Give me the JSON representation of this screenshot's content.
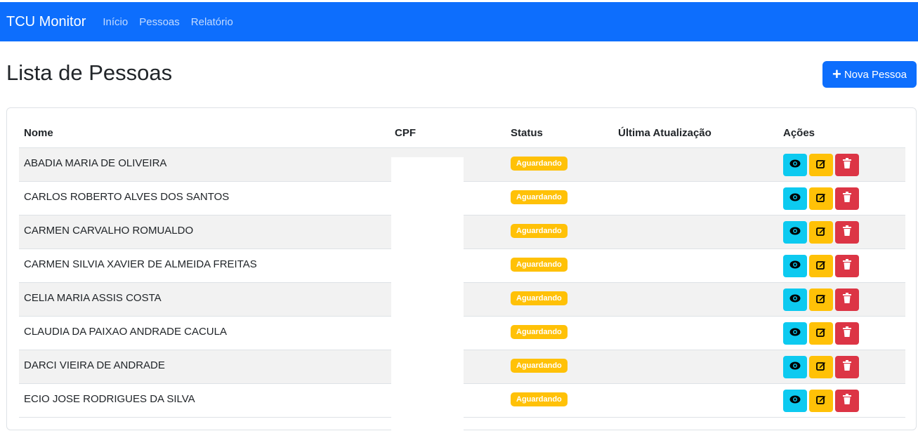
{
  "navbar": {
    "brand": "TCU Monitor",
    "links": [
      "Início",
      "Pessoas",
      "Relatório"
    ]
  },
  "page": {
    "title": "Lista de Pessoas",
    "new_button": "Nova Pessoa"
  },
  "table": {
    "headers": [
      "Nome",
      "CPF",
      "Status",
      "Última Atualização",
      "Ações"
    ],
    "rows": [
      {
        "name": "ABADIA MARIA DE OLIVEIRA",
        "status": "Aguardando"
      },
      {
        "name": "CARLOS ROBERTO ALVES DOS SANTOS",
        "status": "Aguardando"
      },
      {
        "name": "CARMEN CARVALHO ROMUALDO",
        "status": "Aguardando"
      },
      {
        "name": "CARMEN SILVIA XAVIER DE ALMEIDA FREITAS",
        "status": "Aguardando"
      },
      {
        "name": "CELIA MARIA ASSIS COSTA",
        "status": "Aguardando"
      },
      {
        "name": "CLAUDIA DA PAIXAO ANDRADE CACULA",
        "status": "Aguardando"
      },
      {
        "name": "DARCI VIEIRA DE ANDRADE",
        "status": "Aguardando"
      },
      {
        "name": "ECIO JOSE RODRIGUES DA SILVA",
        "status": "Aguardando"
      }
    ]
  },
  "icons": {
    "view": "eye-icon",
    "edit": "edit-icon",
    "delete": "trash-icon",
    "new": "plus-icon"
  },
  "colors": {
    "primary": "#0d6efd",
    "info": "#0dcaf0",
    "warning": "#ffc107",
    "danger": "#dc3545"
  }
}
